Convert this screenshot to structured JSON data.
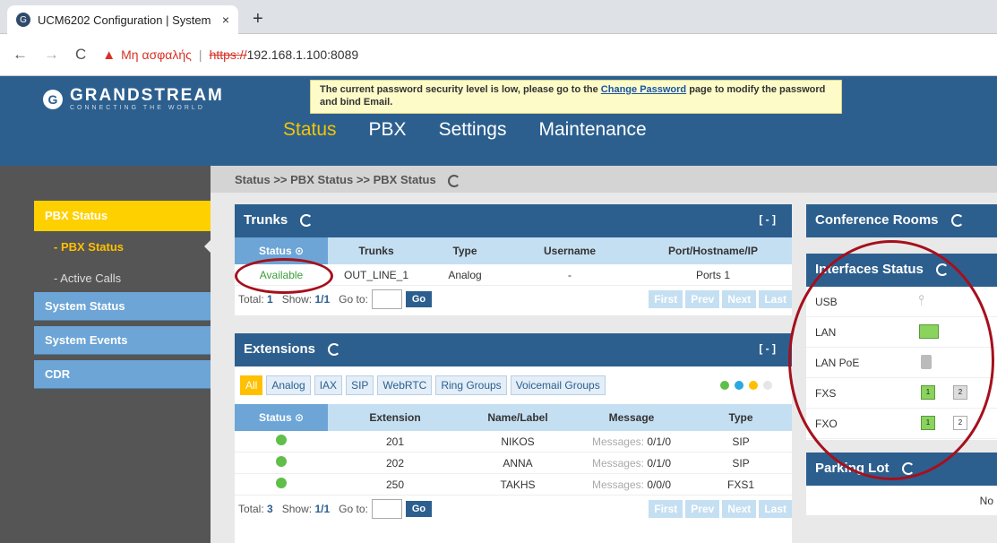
{
  "browser": {
    "tab_title": "UCM6202 Configuration | System",
    "tab_close": "×",
    "new_tab": "+",
    "back": "←",
    "forward": "→",
    "reload": "C",
    "security_warning": "Μη ασφαλής",
    "separator": "|",
    "url_scheme": "https://",
    "url_rest": "192.168.1.100:8089"
  },
  "header": {
    "logo_brand": "GRANDSTREAM",
    "logo_tagline": "CONNECTING THE WORLD",
    "alert_before": "The current password security level is low, please go to the ",
    "alert_link": "Change Password",
    "alert_after": " page to modify the password and bind Email.",
    "nav": [
      "Status",
      "PBX",
      "Settings",
      "Maintenance"
    ]
  },
  "sidebar": {
    "section": "PBX Status",
    "sub_items": [
      "- PBX Status",
      "- Active Calls"
    ],
    "items": [
      "System Status",
      "System Events",
      "CDR"
    ]
  },
  "breadcrumb": "Status >> PBX Status >> PBX Status",
  "trunks": {
    "title": "Trunks",
    "collapse": "[ - ]",
    "columns": [
      "Status ⊙",
      "Trunks",
      "Type",
      "Username",
      "Port/Hostname/IP"
    ],
    "rows": [
      {
        "status": "Available",
        "trunk": "OUT_LINE_1",
        "type": "Analog",
        "username": "-",
        "port": "Ports 1"
      }
    ],
    "pager": {
      "total_label": "Total:",
      "total": "1",
      "show_label": "Show:",
      "show": "1/1",
      "goto_label": "Go to:",
      "go": "Go",
      "first": "First",
      "prev": "Prev",
      "next": "Next",
      "last": "Last"
    }
  },
  "extensions": {
    "title": "Extensions",
    "collapse": "[ - ]",
    "filters": [
      "All",
      "Analog",
      "IAX",
      "SIP",
      "WebRTC",
      "Ring Groups",
      "Voicemail Groups"
    ],
    "legend_colors": [
      "#5fbf4a",
      "#2aa9e0",
      "#ffc000",
      "#e6e6e6"
    ],
    "columns": [
      "Status ⊙",
      "Extension",
      "Name/Label",
      "Message",
      "Type"
    ],
    "rows": [
      {
        "extension": "201",
        "name": "NIKOS",
        "message_label": "Messages:",
        "message": "0/1/0",
        "type": "SIP"
      },
      {
        "extension": "202",
        "name": "ANNA",
        "message_label": "Messages:",
        "message": "0/1/0",
        "type": "SIP"
      },
      {
        "extension": "250",
        "name": "TAKHS",
        "message_label": "Messages:",
        "message": "0/0/0",
        "type": "FXS1"
      }
    ],
    "pager": {
      "total_label": "Total:",
      "total": "3",
      "show_label": "Show:",
      "show": "1/1",
      "goto_label": "Go to:",
      "go": "Go",
      "first": "First",
      "prev": "Prev",
      "next": "Next",
      "last": "Last"
    }
  },
  "conference": {
    "title": "Conference Rooms"
  },
  "interfaces": {
    "title": "Interfaces Status",
    "rows": [
      "USB",
      "LAN",
      "LAN PoE",
      "FXS",
      "FXO"
    ],
    "fxs_ports": [
      "1",
      "2"
    ],
    "fxo_ports": [
      "1",
      "2"
    ]
  },
  "parking": {
    "title": "Parking Lot",
    "body": "No"
  }
}
